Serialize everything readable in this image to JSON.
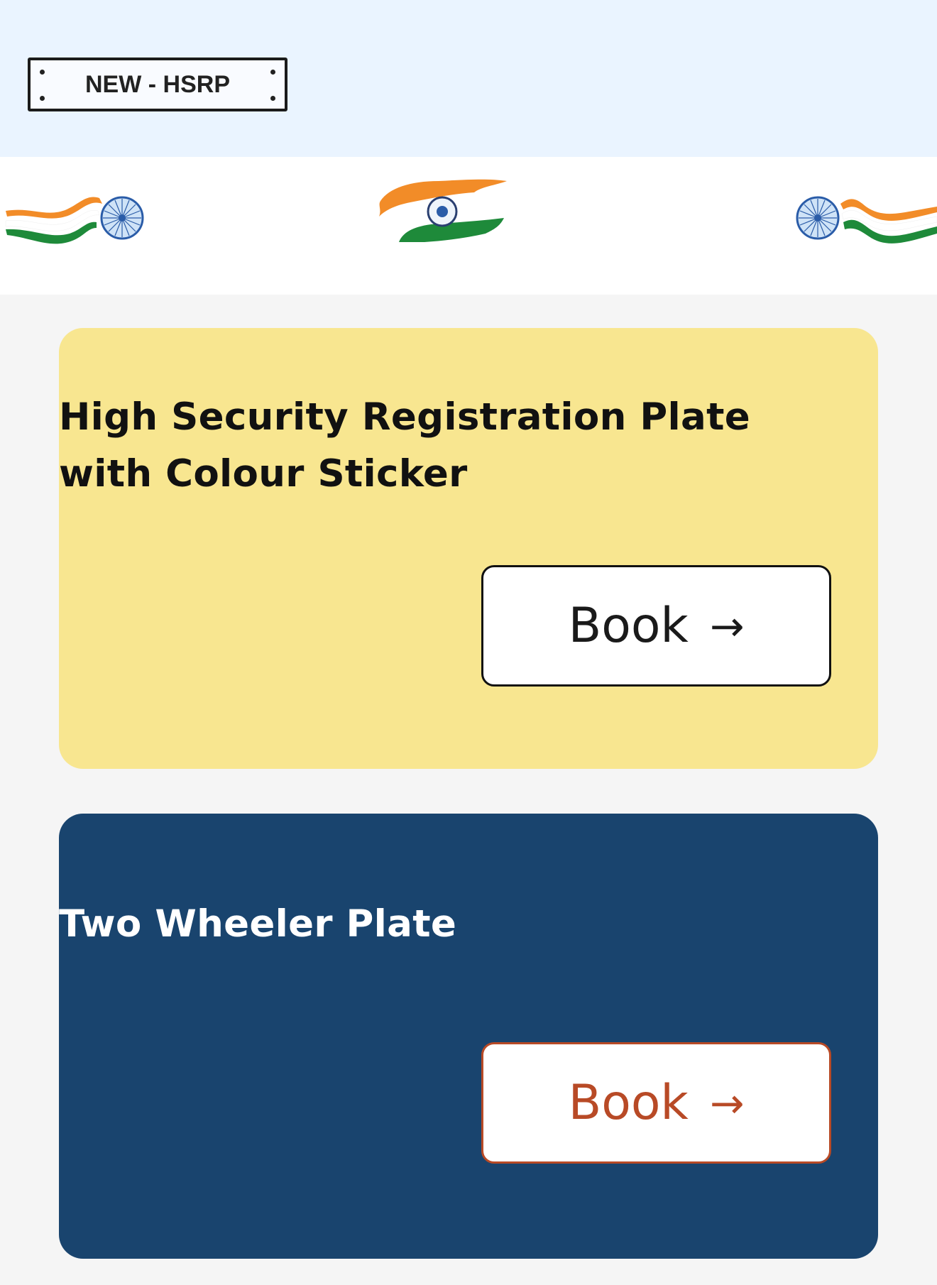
{
  "header": {
    "logo_text": "NEW - HSRP",
    "background": "#eaf4ff"
  },
  "banner": {
    "icons": [
      "flag-ribbon-left",
      "flag-brush-center",
      "flag-ribbon-right"
    ],
    "colors": {
      "saffron": "#f28c28",
      "green": "#1e8a3a",
      "chakra": "#2a5ca8"
    }
  },
  "cards": [
    {
      "title": "High Security Registration Plate with Colour Sticker",
      "button_label": "Book",
      "button_arrow": "→",
      "background": "#f8e690",
      "button_color": "#111111"
    },
    {
      "title": "Two Wheeler Plate",
      "button_label": "Book",
      "button_arrow": "→",
      "background": "#19446e",
      "button_color": "#b84a26"
    }
  ]
}
